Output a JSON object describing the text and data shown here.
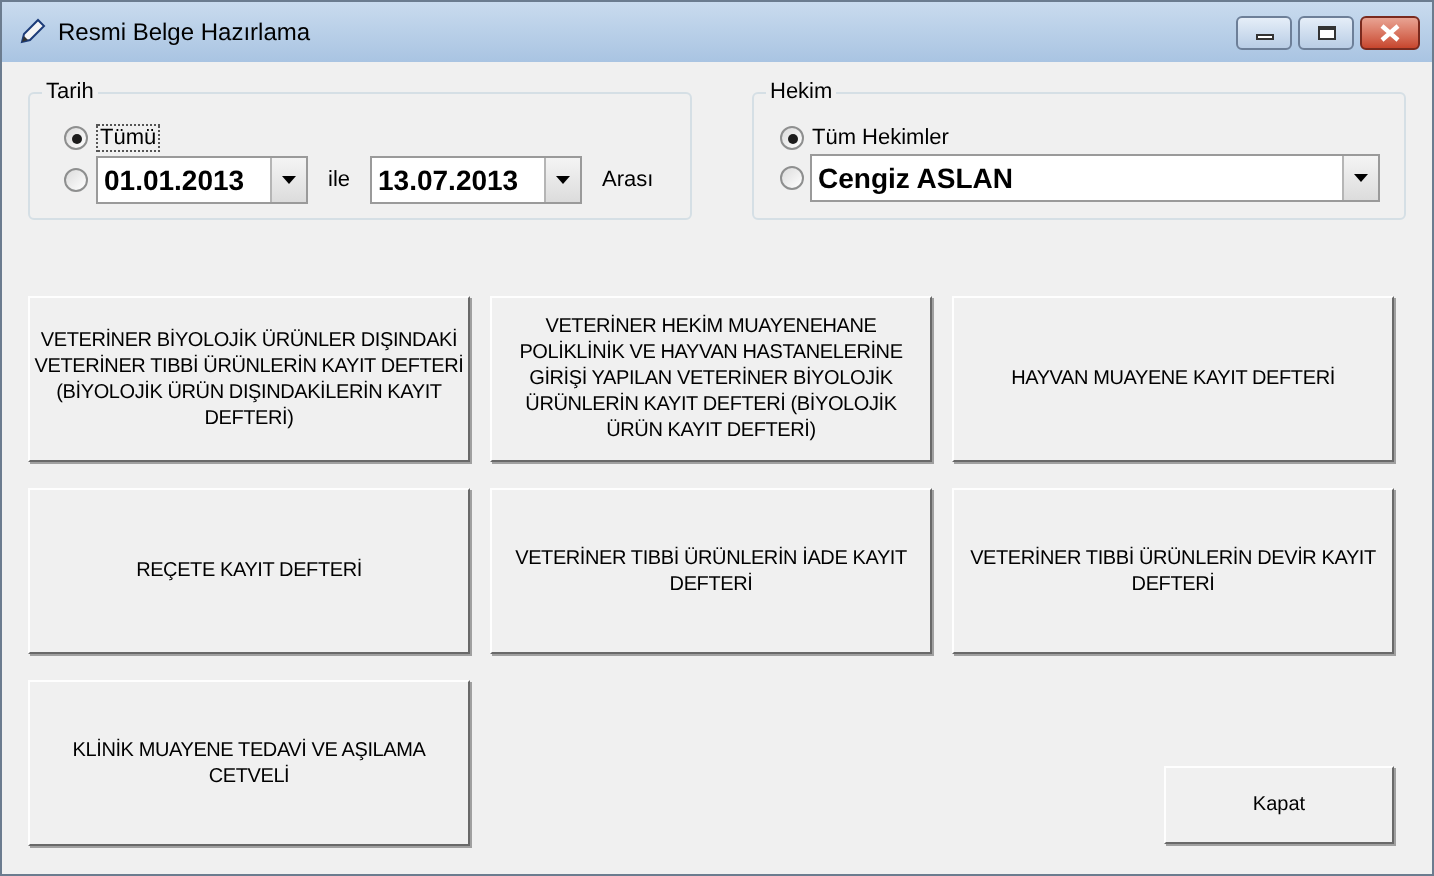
{
  "window": {
    "title": "Resmi Belge Hazırlama"
  },
  "date_group": {
    "title": "Tarih",
    "options": [
      {
        "label": "Tümü",
        "selected": true
      },
      {
        "selected": false
      }
    ],
    "from": "01.01.2013",
    "between": "ile",
    "to": "13.07.2013",
    "suffix": "Arası"
  },
  "doctor_group": {
    "title": "Hekim",
    "options": [
      {
        "label": "Tüm Hekimler",
        "selected": true
      },
      {
        "selected": false
      }
    ],
    "doctor": "Cengiz ASLAN"
  },
  "buttons": [
    {
      "label": "VETERİNER BİYOLOJİK ÜRÜNLER DIŞINDAKİ VETERİNER TIBBİ ÜRÜNLERİN KAYIT DEFTERİ (BİYOLOJİK ÜRÜN DIŞINDAKİLERİN KAYIT DEFTERİ)"
    },
    {
      "label": "VETERİNER HEKİM MUAYENEHANE POLİKLİNİK VE HAYVAN HASTANELERİNE GİRİŞİ YAPILAN VETERİNER BİYOLOJİK ÜRÜNLERİN KAYIT DEFTERİ (BİYOLOJİK ÜRÜN KAYIT DEFTERİ)"
    },
    {
      "label": "HAYVAN MUAYENE KAYIT DEFTERİ"
    },
    {
      "label": "REÇETE KAYIT DEFTERİ"
    },
    {
      "label": "VETERİNER TIBBİ ÜRÜNLERİN İADE KAYIT DEFTERİ"
    },
    {
      "label": "VETERİNER TIBBİ ÜRÜNLERİN DEVİR KAYIT DEFTERİ"
    },
    {
      "label": "KLİNİK MUAYENE TEDAVİ VE AŞILAMA CETVELİ"
    }
  ],
  "close_button": "Kapat"
}
